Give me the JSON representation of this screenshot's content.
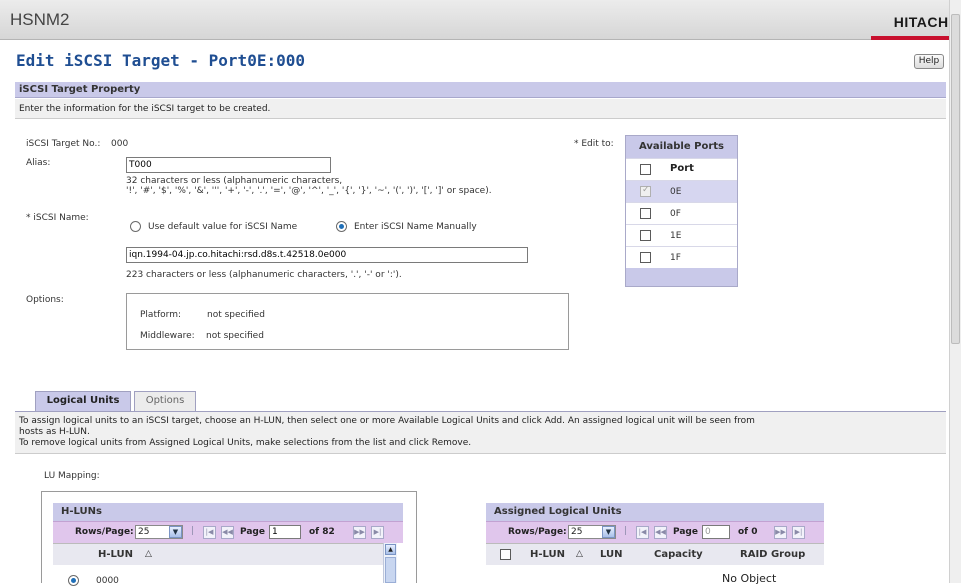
{
  "app": {
    "name": "HSNM2",
    "brand": "HITACHI"
  },
  "page": {
    "title": "Edit iSCSI Target - Port0E:000",
    "help_label": "Help"
  },
  "property": {
    "heading": "iSCSI Target Property",
    "description": "Enter the information for the iSCSI target to be created.",
    "target_no_label": "iSCSI Target No.:",
    "target_no_value": "000",
    "alias_label": "Alias:",
    "alias_value": "T000",
    "alias_hint_1": "32 characters or less (alphanumeric characters,",
    "alias_hint_2": "'!', '#', '$', '%', '&', ''', '+', '-', '.', '=', '@', '^', '_', '{', '}', '~', '(', ')', '[', ']' or space).",
    "iscsi_name_label": "* iSCSI Name:",
    "radio_default_label": "Use default value for iSCSI Name",
    "radio_manual_label": "Enter iSCSI Name Manually",
    "iscsi_name_value": "iqn.1994-04.jp.co.hitachi:rsd.d8s.t.42518.0e000",
    "iscsi_name_hint": "223 characters or less (alphanumeric characters, '.', '-' or ':').",
    "options_label": "Options:",
    "platform_label": "Platform:",
    "platform_value": "not specified",
    "middleware_label": "Middleware:",
    "middleware_value": "not specified",
    "edit_to_label": "* Edit to:"
  },
  "ports": {
    "heading": "Available Ports",
    "column": "Port",
    "rows": [
      {
        "port": "0E",
        "checked": true,
        "disabled": true
      },
      {
        "port": "0F",
        "checked": false,
        "disabled": false
      },
      {
        "port": "1E",
        "checked": false,
        "disabled": false
      },
      {
        "port": "1F",
        "checked": false,
        "disabled": false
      }
    ]
  },
  "tabs": [
    {
      "label": "Logical Units",
      "active": true
    },
    {
      "label": "Options",
      "active": false
    }
  ],
  "lu": {
    "desc_1": "To assign logical units to an iSCSI target, choose an H-LUN, then select one or more Available Logical Units and click Add. An assigned logical unit will be seen from",
    "desc_2": "hosts as H-LUN.",
    "desc_3": "To remove logical units from Assigned Logical Units, make selections from the list and click Remove.",
    "mapping_label": "LU Mapping:"
  },
  "hluns": {
    "heading": "H-LUNs",
    "rows_label": "Rows/Page:",
    "rows_value": "25",
    "page_label": "Page",
    "page_value": "1",
    "of_label": "of 82",
    "column": "H-LUN",
    "first_row": "0000"
  },
  "assigned": {
    "heading": "Assigned Logical Units",
    "rows_label": "Rows/Page:",
    "rows_value": "25",
    "page_label": "Page",
    "page_value": "0",
    "of_label": "of 0",
    "columns": [
      "H-LUN",
      "LUN",
      "Capacity",
      "RAID Group"
    ],
    "empty_text": "No Object"
  }
}
